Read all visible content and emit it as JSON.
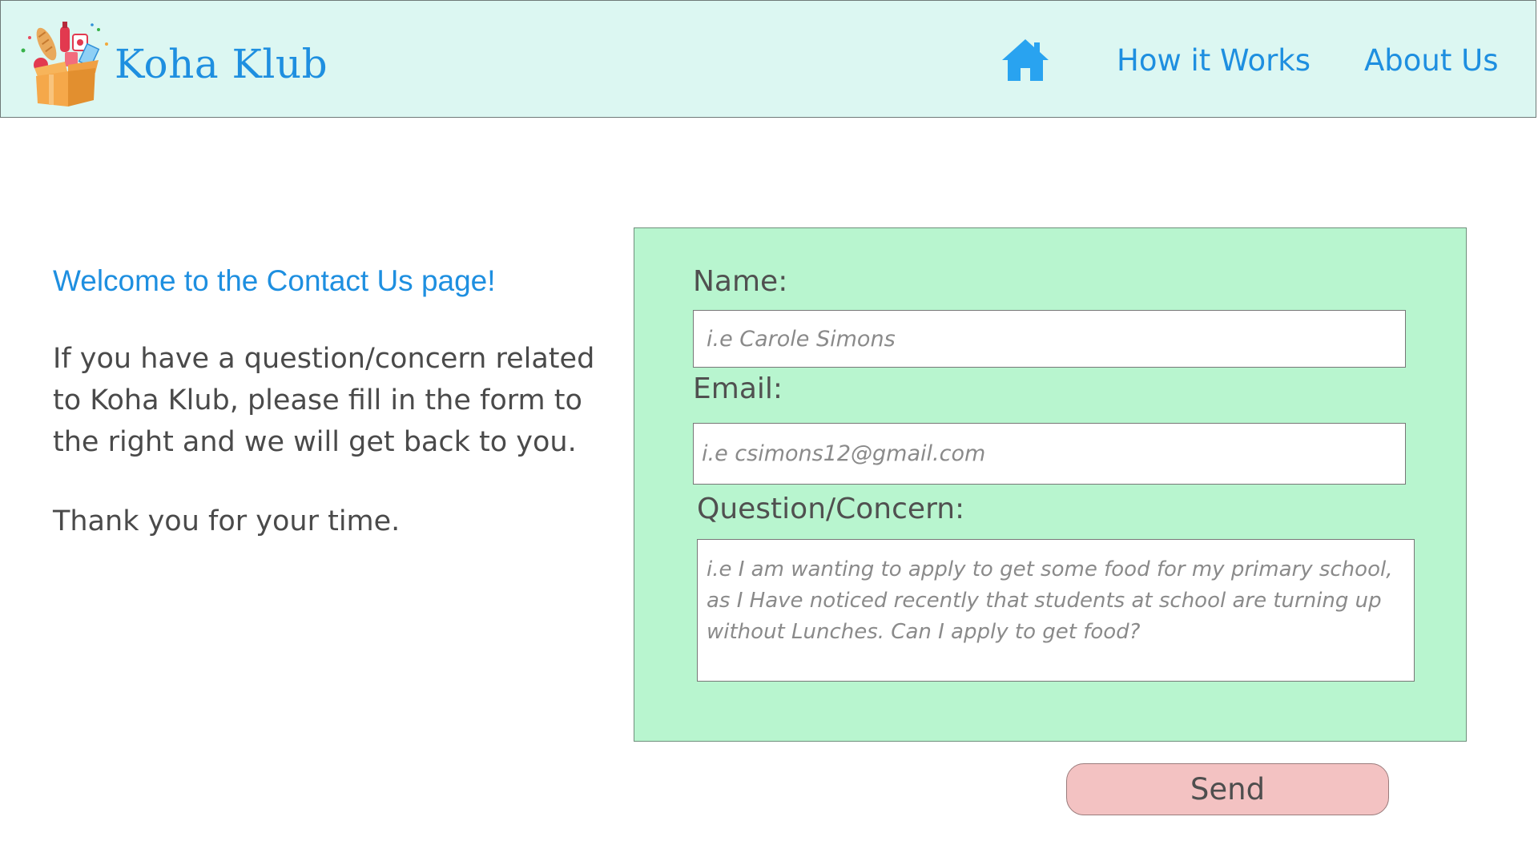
{
  "header": {
    "brand": "Koha Klub",
    "logo_icon": "gift-box-food-icon",
    "home_icon": "home-icon",
    "nav": {
      "how_it_works": "How it Works",
      "about_us": "About Us"
    }
  },
  "intro": {
    "welcome": "Welcome to the Contact Us page!",
    "body": "If you have a question/concern related to Koha Klub, please fill in the form to the right and we will get back to you.",
    "thanks": "Thank you for your time."
  },
  "form": {
    "name_label": "Name:",
    "name_placeholder": "i.e Carole Simons",
    "email_label": "Email:",
    "email_placeholder": "i.e csimons12@gmail.com",
    "question_label": "Question/Concern:",
    "question_placeholder": "i.e I am wanting to apply to get some food for my primary school, as I Have noticed recently that students at school are turning up without Lunches. Can I apply to get food?",
    "send_label": "Send"
  },
  "colors": {
    "accent_blue": "#1e8fe0",
    "header_bg": "#dcf7f2",
    "form_bg": "#b8f5cf",
    "send_bg": "#f3c2c2"
  }
}
